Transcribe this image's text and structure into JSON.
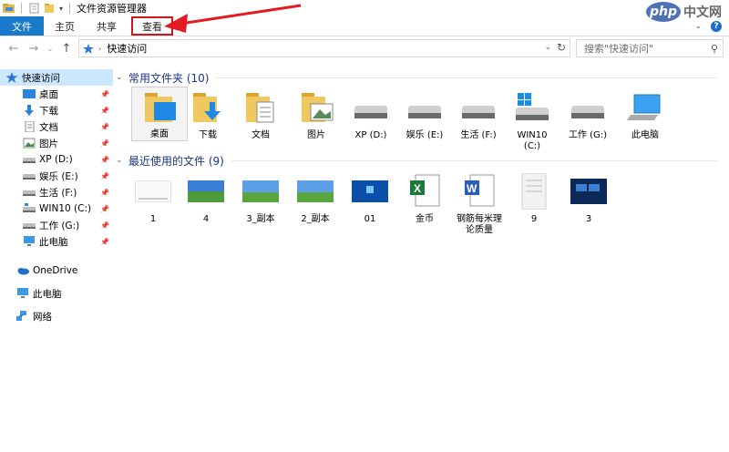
{
  "window": {
    "title": "文件资源管理器"
  },
  "ribbon": {
    "tabs": [
      {
        "label": "文件"
      },
      {
        "label": "主页"
      },
      {
        "label": "共享"
      },
      {
        "label": "查看"
      }
    ],
    "help": "?"
  },
  "watermark": {
    "badge": "php",
    "text": "中文网"
  },
  "address": {
    "path": "快速访问"
  },
  "search": {
    "placeholder": "搜索\"快速访问\""
  },
  "sidebar": {
    "quick_access": "快速访问",
    "items": [
      {
        "label": "桌面"
      },
      {
        "label": "下载"
      },
      {
        "label": "文档"
      },
      {
        "label": "图片"
      },
      {
        "label": "XP (D:)"
      },
      {
        "label": "娱乐 (E:)"
      },
      {
        "label": "生活 (F:)"
      },
      {
        "label": "WIN10 (C:)"
      },
      {
        "label": "工作 (G:)"
      },
      {
        "label": "此电脑"
      }
    ],
    "onedrive": "OneDrive",
    "this_pc": "此电脑",
    "network": "网络"
  },
  "groups": {
    "frequent": {
      "title": "常用文件夹 (10)",
      "items": [
        {
          "label": "桌面"
        },
        {
          "label": "下载"
        },
        {
          "label": "文档"
        },
        {
          "label": "图片"
        },
        {
          "label": "XP (D:)"
        },
        {
          "label": "娱乐 (E:)"
        },
        {
          "label": "生活 (F:)"
        },
        {
          "label": "WIN10 (C:)"
        },
        {
          "label": "工作 (G:)"
        },
        {
          "label": "此电脑"
        }
      ]
    },
    "recent": {
      "title": "最近使用的文件 (9)",
      "items": [
        {
          "label": "1"
        },
        {
          "label": "4"
        },
        {
          "label": "3_副本"
        },
        {
          "label": "2_副本"
        },
        {
          "label": "01"
        },
        {
          "label": "金币"
        },
        {
          "label": "钢筋每米理论质量"
        },
        {
          "label": "9"
        },
        {
          "label": "3"
        }
      ]
    }
  },
  "colors": {
    "accent": "#1979ca",
    "highlight": "#d0161b",
    "group_title": "#1e3287"
  }
}
